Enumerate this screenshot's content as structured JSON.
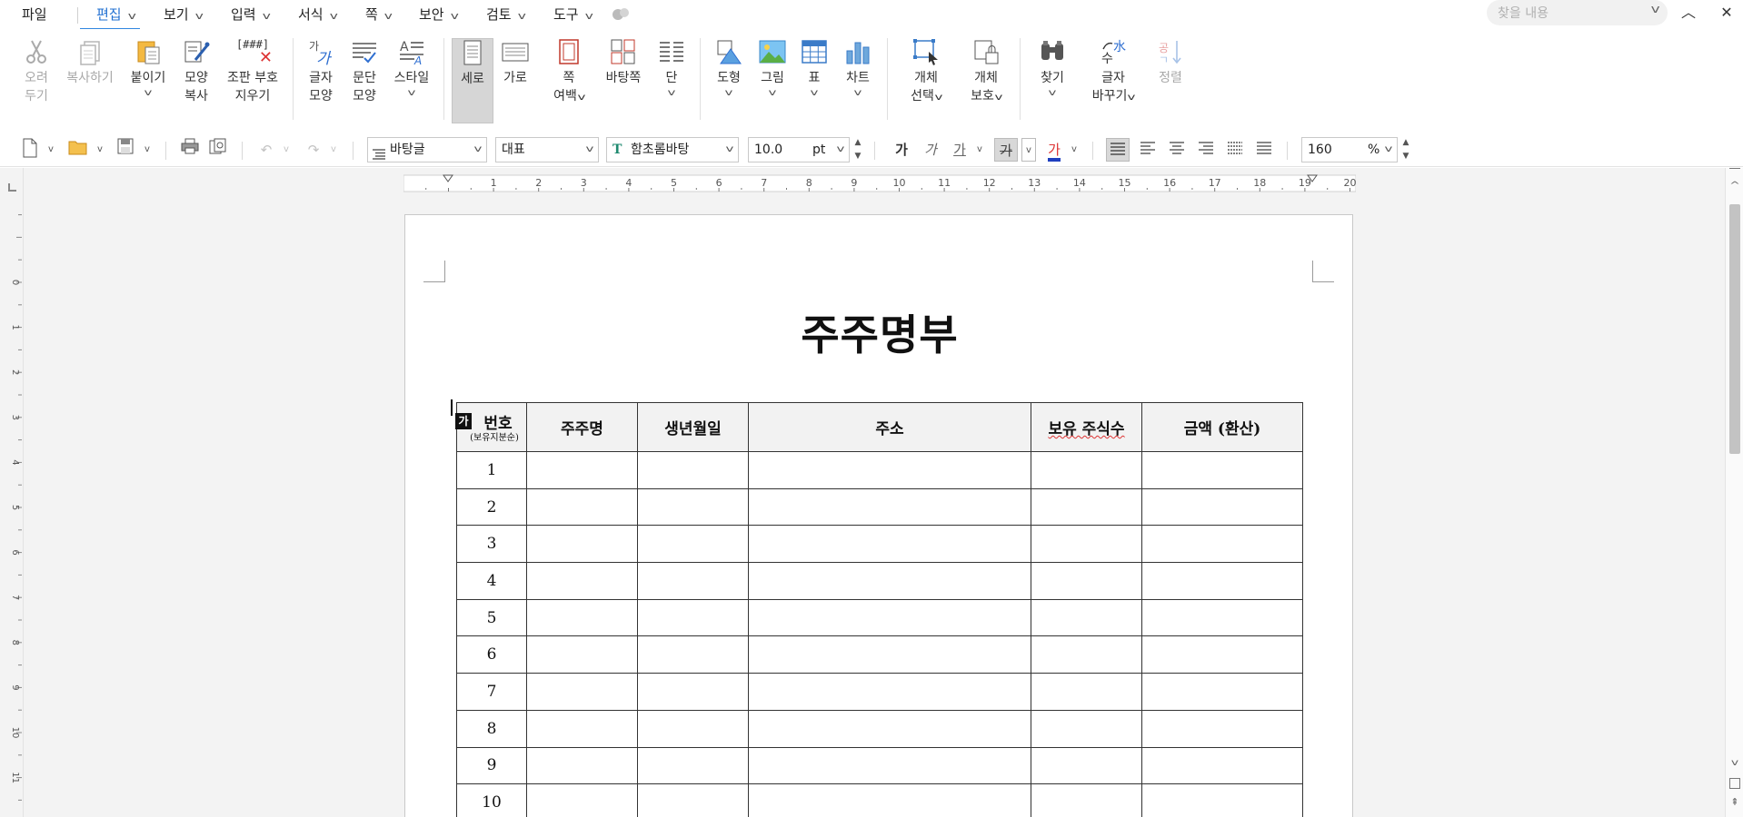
{
  "menu": {
    "file": "파일",
    "items": [
      "편집",
      "보기",
      "입력",
      "서식",
      "쪽",
      "보안",
      "검토",
      "도구"
    ],
    "active": "편집",
    "search_placeholder": "찾을 내용"
  },
  "ribbon": {
    "cut": [
      "오려",
      "두기"
    ],
    "copy": "복사하기",
    "paste": "붙이기",
    "format_copy": [
      "모양",
      "복사"
    ],
    "clear_marks": [
      "조판 부호",
      "지우기"
    ],
    "clear_marks_icon_text": "[###]",
    "char_shape": [
      "글자",
      "모양"
    ],
    "para_shape": [
      "문단",
      "모양"
    ],
    "style": "스타일",
    "portrait": "세로",
    "landscape": "가로",
    "margins": [
      "쪽",
      "여백"
    ],
    "master_page": "바탕쪽",
    "columns": "단",
    "shapes": "도형",
    "picture": "그림",
    "table": "표",
    "chart": "차트",
    "select_object": [
      "개체",
      "선택"
    ],
    "protect_object": [
      "개체",
      "보호"
    ],
    "find": "찾기",
    "replace": [
      "글자",
      "바꾸기"
    ],
    "sort": "정렬"
  },
  "toolbar": {
    "style_value": "바탕글",
    "outline_value": "대표",
    "font_value": "함초롬바탕",
    "size_value": "10.0",
    "size_unit": "pt",
    "zoom_value": "160",
    "zoom_unit": "%",
    "bold_glyph": "가",
    "italic_glyph": "가",
    "underline_glyph": "가",
    "strike_glyph": "가",
    "color_glyph": "가"
  },
  "ruler": {
    "h_marks": [
      "1",
      "2",
      "3",
      "4",
      "5",
      "6",
      "7",
      "8",
      "9",
      "10",
      "11",
      "12",
      "13",
      "14",
      "15",
      "16",
      "17",
      "18",
      "19",
      "20"
    ],
    "v_marks": [
      "0",
      "1",
      "2",
      "3",
      "4",
      "5",
      "6",
      "7",
      "8",
      "9",
      "10",
      "11"
    ]
  },
  "document": {
    "title": "주주명부",
    "cursor_marker": "가",
    "table": {
      "headers": [
        "번호",
        "주주명",
        "생년월일",
        "주소",
        "보유 주식수",
        "금액 (환산)"
      ],
      "header_sub": "(보유지분순)",
      "row_numbers": [
        "1",
        "2",
        "3",
        "4",
        "5",
        "6",
        "7",
        "8",
        "9",
        "10"
      ]
    }
  },
  "colors": {
    "accent": "#2f86e0",
    "table_header_bg": "#f2f2f2"
  }
}
